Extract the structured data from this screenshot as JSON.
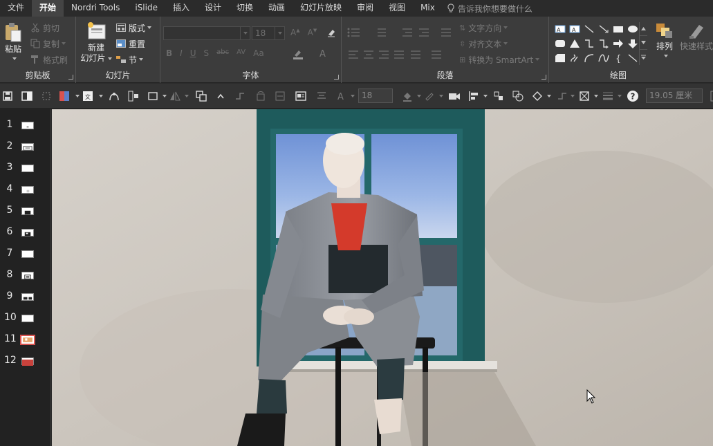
{
  "menu": {
    "tabs": [
      "文件",
      "开始",
      "Nordri Tools",
      "iSlide",
      "插入",
      "设计",
      "切换",
      "动画",
      "幻灯片放映",
      "审阅",
      "视图",
      "Mix"
    ],
    "active_index": 1,
    "tell_me": "告诉我你想要做什么"
  },
  "ribbon": {
    "clipboard": {
      "label": "剪贴板",
      "paste": "粘贴",
      "cut": "剪切",
      "copy": "复制",
      "format_painter": "格式刷"
    },
    "slides": {
      "label": "幻灯片",
      "new_slide_line1": "新建",
      "new_slide_line2": "幻灯片",
      "layout": "版式",
      "reset": "重置",
      "section": "节"
    },
    "font": {
      "label": "字体",
      "font_name": "",
      "font_size": "18"
    },
    "paragraph": {
      "label": "段落",
      "text_direction": "文字方向",
      "align_text": "对齐文本",
      "convert_smartart": "转换为 SmartArt"
    },
    "drawing": {
      "label": "绘图",
      "arrange": "排列",
      "quick_styles": "快速样式"
    }
  },
  "qat": {
    "font_size": "18",
    "width_value": "19.05 厘米"
  },
  "slides": [
    {
      "num": "1"
    },
    {
      "num": "2"
    },
    {
      "num": "3"
    },
    {
      "num": "4"
    },
    {
      "num": "5"
    },
    {
      "num": "6"
    },
    {
      "num": "7"
    },
    {
      "num": "8"
    },
    {
      "num": "9"
    },
    {
      "num": "10"
    },
    {
      "num": "11"
    },
    {
      "num": "12"
    }
  ],
  "selected_slide": 11,
  "colors": {
    "accent_tab": "#444444",
    "selected_slide_border": "#d9534f",
    "window_frame": "#1e5b5c"
  }
}
